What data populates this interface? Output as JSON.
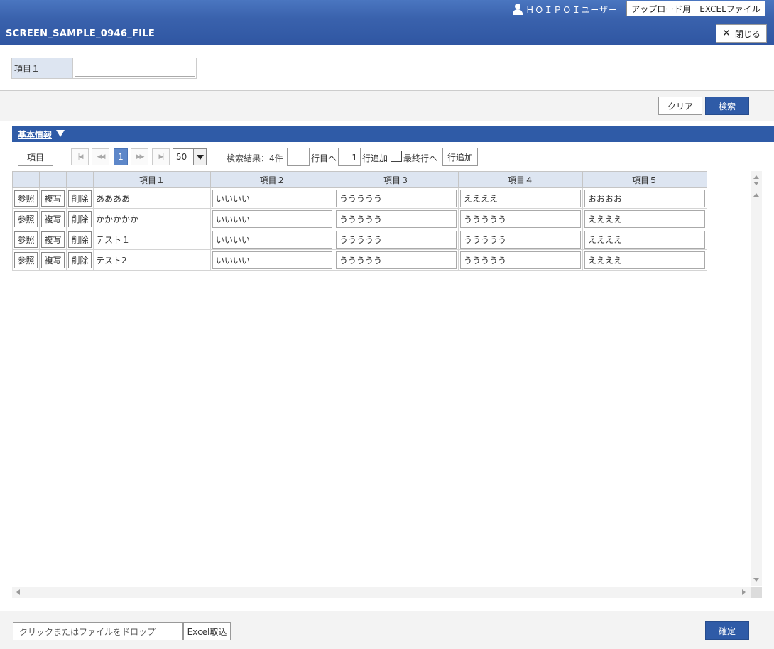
{
  "header": {
    "user_name": "ＨＯＩＰＯＩユーザー",
    "excel_upload_label": "アップロード用　EXCELファイル",
    "page_title": "SCREEN_SAMPLE_0946_FILE",
    "close_label": "閉じる",
    "background_color": "#2f56a2"
  },
  "search": {
    "field_label": "項目１",
    "field_value": "",
    "clear_label": "クリア",
    "search_label": "検索"
  },
  "section": {
    "title": "基本情報"
  },
  "toolbar": {
    "column_button_label": "項目",
    "current_page": "1",
    "page_size": "50",
    "result_text": "検索結果：4件",
    "goto_label": "行目へ",
    "addrow_count": "1",
    "addrow_label": "行追加",
    "lastrow_label": "最終行へ",
    "addrow_button_label": "行追加"
  },
  "grid": {
    "columns": [
      "項目１",
      "項目２",
      "項目３",
      "項目４",
      "項目５"
    ],
    "row_buttons": {
      "view": "参照",
      "copy": "複写",
      "delete": "削除"
    },
    "rows": [
      {
        "c1": "ああああ",
        "c2": "いいいい",
        "c3": "ううううう",
        "c4": "ええええ",
        "c5": "おおおお"
      },
      {
        "c1": "かかかかか",
        "c2": "いいいい",
        "c3": "ううううう",
        "c4": "ううううう",
        "c5": "ええええ"
      },
      {
        "c1": "テスト１",
        "c2": "いいいい",
        "c3": "ううううう",
        "c4": "ううううう",
        "c5": "ええええ"
      },
      {
        "c1": "テスト2",
        "c2": "いいいい",
        "c3": "ううううう",
        "c4": "ううううう",
        "c5": "ええええ"
      }
    ]
  },
  "footer": {
    "file_drop_placeholder": "クリックまたはファイルをドロップ",
    "excel_import_label": "Excel取込",
    "confirm_label": "確定",
    "accent_color": "#2f5ba7"
  }
}
